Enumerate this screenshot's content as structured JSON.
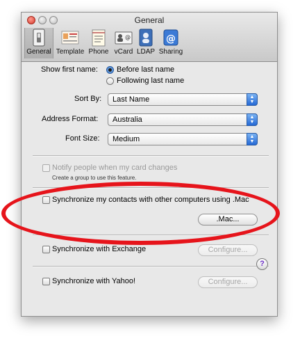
{
  "window": {
    "title": "General",
    "toolbar": [
      {
        "label": "General",
        "icon": "general-switch-icon",
        "selected": true
      },
      {
        "label": "Template",
        "icon": "template-card-icon",
        "selected": false
      },
      {
        "label": "Phone",
        "icon": "phone-notepad-icon",
        "selected": false
      },
      {
        "label": "vCard",
        "icon": "vcard-icon",
        "selected": false
      },
      {
        "label": "LDAP",
        "icon": "ldap-directory-icon",
        "selected": false
      },
      {
        "label": "Sharing",
        "icon": "sharing-at-icon",
        "selected": false
      }
    ]
  },
  "general": {
    "show_first_name_label": "Show first name:",
    "radio_options": [
      "Before last name",
      "Following last name"
    ],
    "selected_radio": 0,
    "sort_by": {
      "label": "Sort By:",
      "value": "Last Name"
    },
    "address_format": {
      "label": "Address Format:",
      "value": "Australia"
    },
    "font_size": {
      "label": "Font Size:",
      "value": "Medium"
    }
  },
  "notify": {
    "label": "Notify people when my card changes",
    "hint": "Create a group to use this feature.",
    "enabled": false
  },
  "mac_sync": {
    "label": "Synchronize my contacts with other computers using .Mac",
    "button": ".Mac..."
  },
  "exchange": {
    "label": "Synchronize with Exchange",
    "button": "Configure..."
  },
  "yahoo": {
    "label": "Synchronize with Yahoo!",
    "button": "Configure..."
  },
  "help": {
    "label": "?"
  },
  "colors": {
    "annotation": "#e6141b",
    "accent": "#2468d4",
    "help_glyph": "#6b2fc8"
  }
}
